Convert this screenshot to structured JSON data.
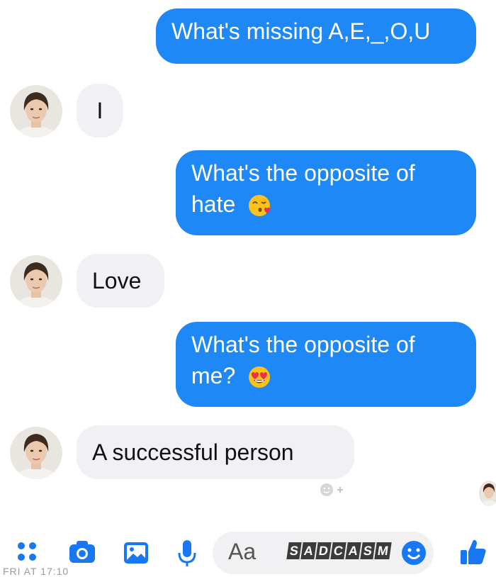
{
  "messages": [
    {
      "dir": "out",
      "text": "What's missing A,E,_,O,U"
    },
    {
      "dir": "in",
      "text": "I"
    },
    {
      "dir": "out",
      "line1": "What's the opposite of",
      "line2": "hate",
      "emoji": "kissing-heart-emoji"
    },
    {
      "dir": "in",
      "text": "Love"
    },
    {
      "dir": "out",
      "line1": "What's the opposite of",
      "line2": "me?",
      "emoji": "heart-eyes-emoji"
    },
    {
      "dir": "in",
      "text": "A successful person"
    }
  ],
  "composer": {
    "placeholder": "Aa",
    "watermark": [
      "S",
      "A",
      "D",
      "C",
      "A",
      "S",
      "M"
    ],
    "timestamp": "FRI AT 17:10"
  },
  "icons": [
    "menu-dots-icon",
    "camera-icon",
    "gallery-icon",
    "microphone-icon",
    "emoji-icon",
    "like-icon",
    "add-reaction-icon"
  ],
  "colors": {
    "outgoing_bubble": "#1d88f6",
    "incoming_bubble": "#f1f0f5",
    "accent": "#1877f2"
  }
}
